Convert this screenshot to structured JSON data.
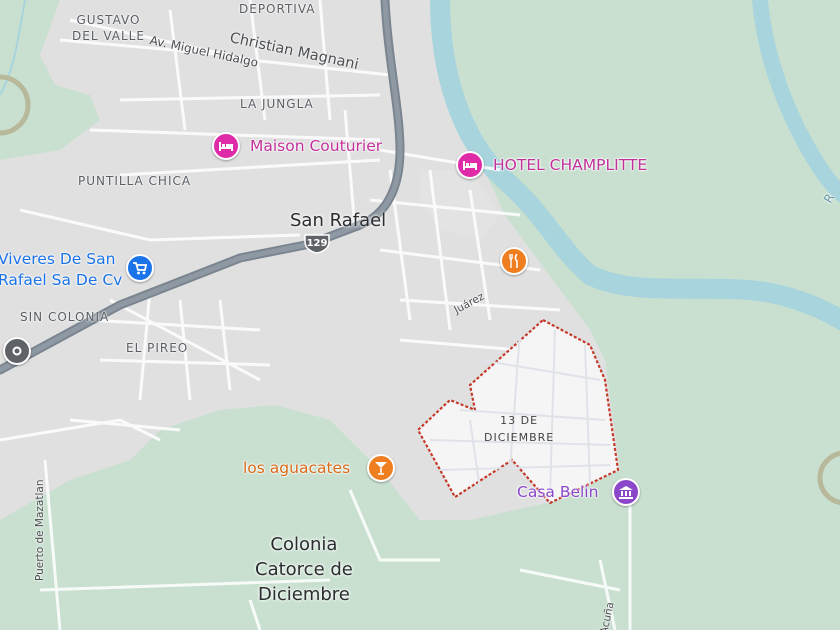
{
  "colors": {
    "water": "#a8d4dd",
    "urban": "#e0e0e0",
    "vegetation": "#c9e0d0",
    "road_major": "#7a8590",
    "road_minor": "#ffffff",
    "highlight_border": "#c43a2a",
    "lodging_pin": "#e02ba8",
    "food_pin": "#ef7e21",
    "shop_pin": "#1a73e8",
    "museum_pin": "#8b47c9",
    "generic_pin": "#5f6368",
    "lodging_text": "#c2319a",
    "food_text": "#d96a17",
    "shop_text": "#1a73e8",
    "museum_text": "#8b47c9"
  },
  "areas": [
    {
      "id": "gustavo-del-valle",
      "line1": "GUSTAVO",
      "line2": "DEL VALLE"
    },
    {
      "id": "deportiva",
      "text": "DEPORTIVA"
    },
    {
      "id": "la-jungla",
      "text": "LA JUNGLA"
    },
    {
      "id": "puntilla-chica",
      "text": "PUNTILLA CHICA"
    },
    {
      "id": "sin-colonia",
      "text": "SIN COLONIA"
    },
    {
      "id": "el-pireo",
      "text": "EL PIREO"
    }
  ],
  "streets": {
    "christian_magnani": "Christian Magnani",
    "miguel_hidalgo": "Av. Miguel Hidalgo",
    "juarez": "Juárez",
    "puerto_de_mazatlan": "Puerto de Mazatlan",
    "acuna": "Acuña",
    "river_label": "R"
  },
  "city": {
    "name": "San Rafael",
    "route_number": "129"
  },
  "district": {
    "line1": "13 DE",
    "line2": "DICIEMBRE"
  },
  "colonia": {
    "line1": "Colonia",
    "line2": "Catorce de",
    "line3": "Diciembre"
  },
  "places": {
    "maison": {
      "name": "Maison Couturier",
      "icon": "bed-icon"
    },
    "champlitte": {
      "name": "HOTEL CHAMPLITTE",
      "icon": "bed-icon"
    },
    "viveres": {
      "line1": "Viveres De San",
      "line2": "Rafael Sa De Cv",
      "icon": "shopping-cart-icon"
    },
    "aguacates": {
      "name": "los aguacates",
      "icon": "cocktail-icon"
    },
    "casa_belin": {
      "name": "Casa Belin",
      "icon": "museum-icon"
    },
    "restaurant": {
      "icon": "fork-knife-icon"
    },
    "location_marker": {
      "icon": "location-pin-icon"
    }
  }
}
